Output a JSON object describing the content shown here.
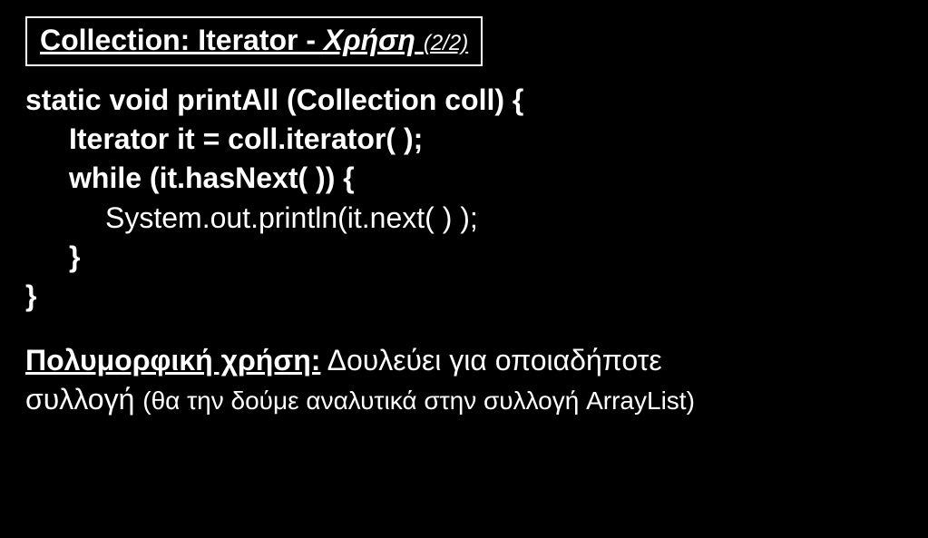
{
  "title": {
    "part1": "Collection: Iterator - ",
    "part2": "Χρήση ",
    "part3": "(2/2)"
  },
  "code": {
    "l1": "static void printAll (Collection coll) {",
    "l2": "Iterator it = coll.iterator( );",
    "l3": "while (it.hasNext( )) {",
    "l4": "System.out.println(it.next( ) );",
    "l5": "}",
    "l6": "}"
  },
  "footer": {
    "label": "Πολυμορφική χρήση:",
    "text1": " Δουλεύει για οποιαδήποτε",
    "text2a": "συλλογή ",
    "text2b": "(θα την δούμε αναλυτικά στην συλλογή ArrayList)"
  }
}
